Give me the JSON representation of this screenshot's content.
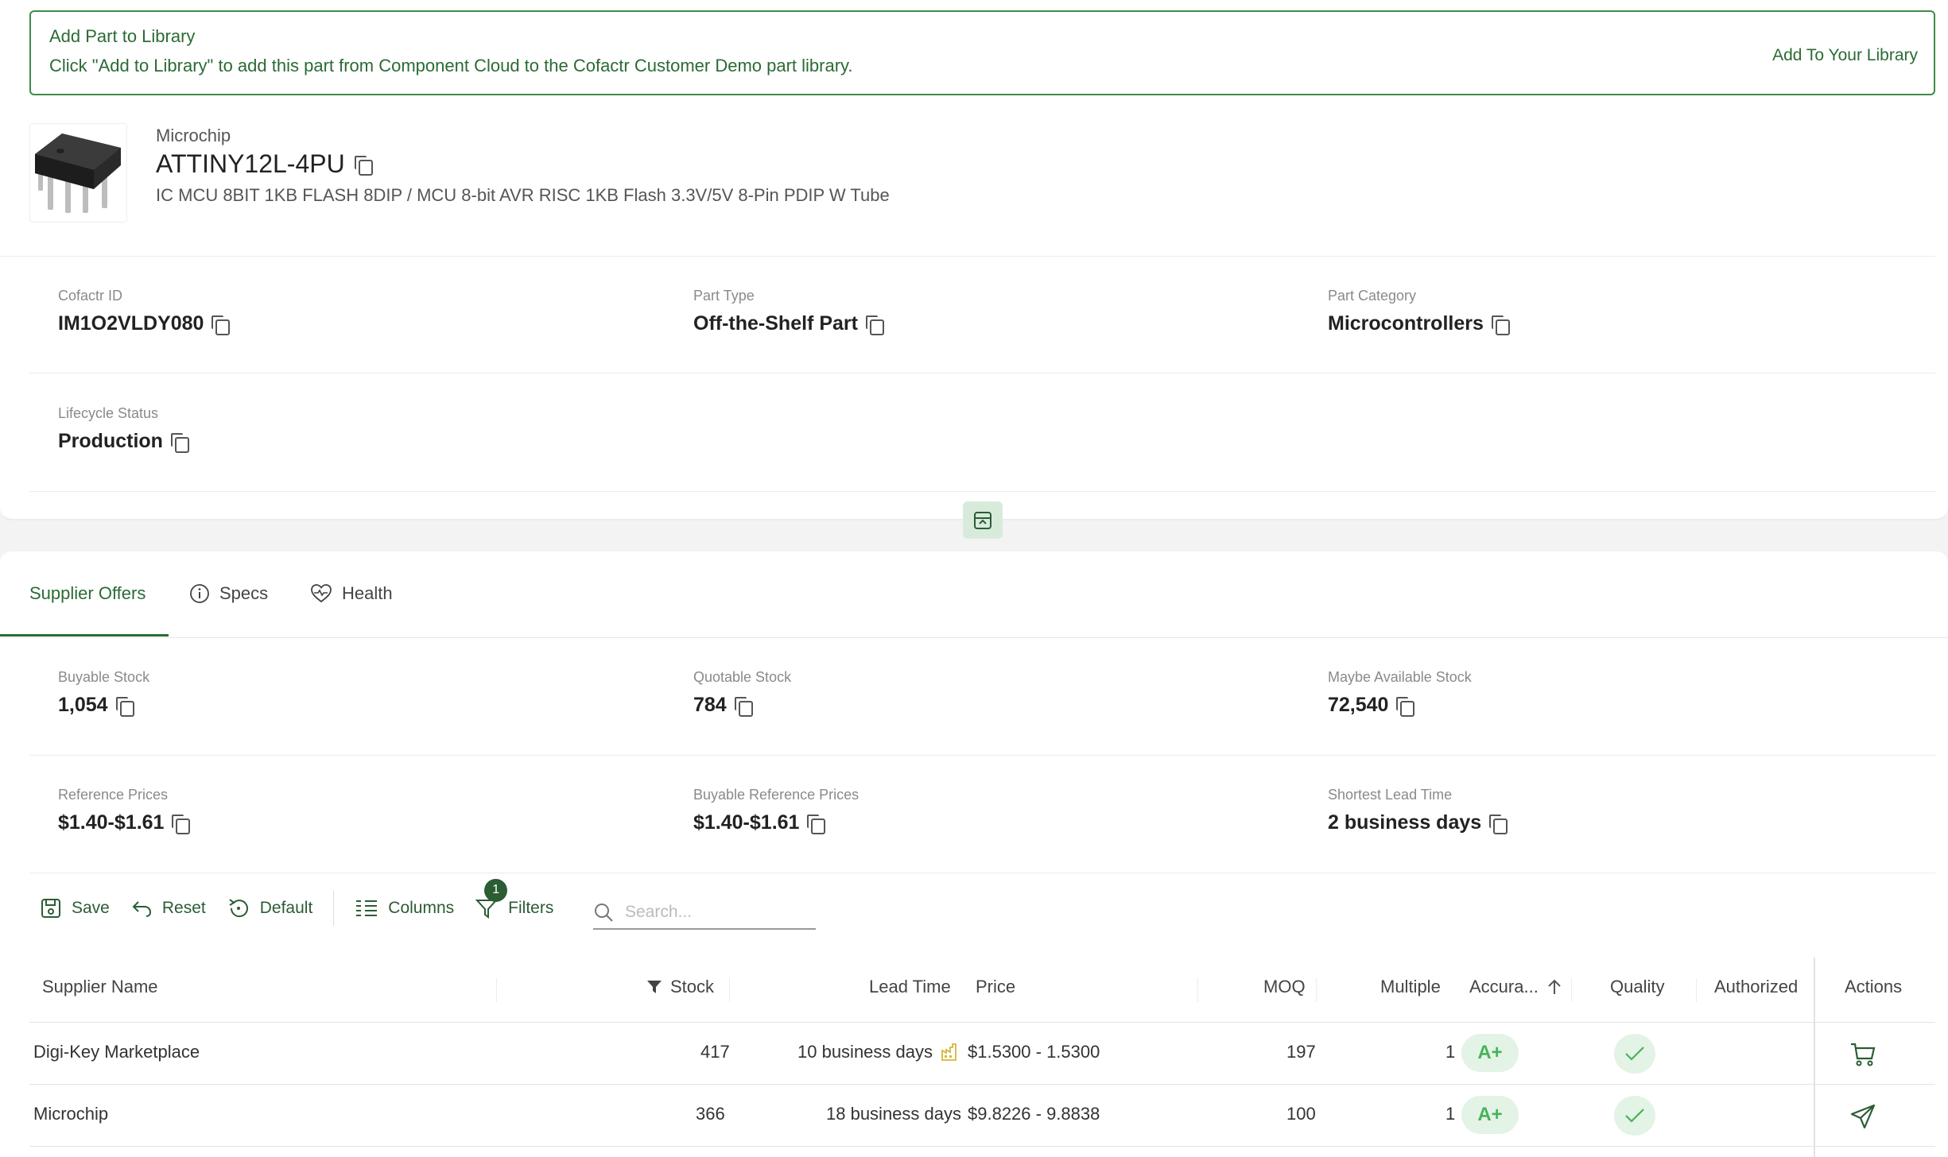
{
  "banner": {
    "title": "Add Part to Library",
    "text": "Click \"Add to Library\" to add this part from Component Cloud to the Cofactr Customer Demo part library.",
    "action": "Add To Your Library"
  },
  "part": {
    "manufacturer": "Microchip",
    "number": "ATTINY12L-4PU",
    "description": "IC MCU 8BIT 1KB FLASH 8DIP / MCU 8-bit AVR RISC 1KB Flash 3.3V/5V 8-Pin PDIP W Tube"
  },
  "fields": {
    "cofactr_id": {
      "label": "Cofactr ID",
      "value": "IM1O2VLDY080"
    },
    "part_type": {
      "label": "Part Type",
      "value": "Off-the-Shelf Part"
    },
    "part_category": {
      "label": "Part Category",
      "value": "Microcontrollers"
    },
    "lifecycle": {
      "label": "Lifecycle Status",
      "value": "Production"
    }
  },
  "tabs": {
    "supplier_offers": "Supplier Offers",
    "specs": "Specs",
    "health": "Health"
  },
  "stats": {
    "buyable_stock": {
      "label": "Buyable Stock",
      "value": "1,054"
    },
    "quotable_stock": {
      "label": "Quotable Stock",
      "value": "784"
    },
    "maybe_stock": {
      "label": "Maybe Available Stock",
      "value": "72,540"
    },
    "reference_prices": {
      "label": "Reference Prices",
      "value": "$1.40-$1.61"
    },
    "buyable_reference_prices": {
      "label": "Buyable Reference Prices",
      "value": "$1.40-$1.61"
    },
    "shortest_lead_time": {
      "label": "Shortest Lead Time",
      "value": "2 business days"
    }
  },
  "toolbar": {
    "save": "Save",
    "reset": "Reset",
    "default": "Default",
    "columns": "Columns",
    "filters": "Filters",
    "filters_count": "1",
    "search_placeholder": "Search..."
  },
  "table": {
    "headers": {
      "supplier": "Supplier Name",
      "stock": "Stock",
      "lead_time": "Lead Time",
      "price": "Price",
      "moq": "MOQ",
      "multiple": "Multiple",
      "accuracy": "Accura...",
      "quality": "Quality",
      "authorized": "Authorized",
      "actions": "Actions"
    },
    "rows": [
      {
        "supplier": "Digi-Key Marketplace",
        "stock": "417",
        "lead_time": "10 business days",
        "price": "$1.5300 - 1.5300",
        "moq": "197",
        "multiple": "1",
        "accuracy": "A+",
        "action_icon": "cart-icon"
      },
      {
        "supplier": "Microchip",
        "stock": "366",
        "lead_time": "18 business days",
        "price": "$9.8226 - 9.8838",
        "moq": "100",
        "multiple": "1",
        "accuracy": "A+",
        "action_icon": "send-icon"
      }
    ]
  },
  "colors": {
    "brand_green": "#2b6b34",
    "grade_green": "#48b25a",
    "factory_icon": "#d9b43a"
  }
}
